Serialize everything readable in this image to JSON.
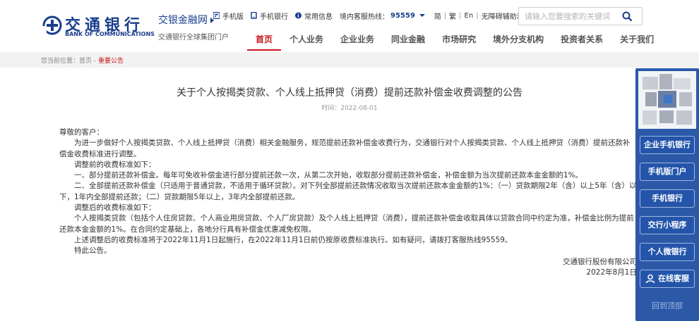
{
  "header": {
    "logo_cn": "交通银行",
    "logo_en": "BANK OF COMMUNICATIONS",
    "brand_title": "交银金融网",
    "brand_sub": "交通银行全球集团门户",
    "links": {
      "mobile_version": "手机版",
      "mobile_bank": "手机银行",
      "common_info": "常用信息",
      "hotline_label": "境内客服热线：",
      "hotline_number": "95559"
    },
    "langs": [
      "简",
      "繁",
      "En",
      "无障碍辅助浏览"
    ],
    "search_placeholder": "请输入您要搜索的关键词"
  },
  "nav": [
    "首页",
    "个人业务",
    "企业业务",
    "同业金融",
    "市场研究",
    "境外分支机构",
    "投资者关系",
    "关于我们"
  ],
  "breadcrumb": {
    "prefix": "您当前位置：首页 - ",
    "current": "重要公告"
  },
  "article": {
    "title": "关于个人按揭类贷款、个人线上抵押贷（消费）提前还款补偿金收费调整的公告",
    "time": "时间：2022-08-01",
    "greeting": "尊敬的客户：",
    "p1": "为进一步做好个人按揭类贷款、个人线上抵押贷（消费）相关金融服务，规范提前还款补偿金收费行为，交通银行对个人按揭类贷款、个人线上抵押贷（消费）提前还款补偿金收费标准进行调整。",
    "p2": "调整前的收费标准如下：",
    "p3": "一、部分提前还款补偿金。每年可免收补偿金进行部分提前还款一次，从第二次开始，收取部分提前还款补偿金，补偿金额为当次提前还款本金金额的1%。",
    "p4": "二、全部提前还款补偿金（只适用于普通贷款，不适用于循环贷款）。对下列全部提前还款情况收取当次提前还款本金金额的1%：（一）贷款期限2年（含）以上5年（含）以下，1年内全部提前还款；（二）贷款期限5年以上，3年内全部提前还款。",
    "p5": "调整后的收费标准如下：",
    "p6": "个人按揭类贷款（包括个人住房贷款、个人商业用房贷款、个人厂房贷款）及个人线上抵押贷（消费），提前还款补偿金收取具体以贷款合同中约定为准，补偿金比例为提前还款本金金额的1%。在合同约定基础上，各地分行具有补偿金优惠减免权限。",
    "p7": "上述调整后的收费标准将于2022年11月1日起施行，在2022年11月1日前仍按原收费标准执行。如有疑问，请拨打客服热线95559。",
    "p8": "特此公告。",
    "sign_org": "交通银行股份有限公司",
    "sign_date": "2022年8月1日"
  },
  "float": {
    "buttons": [
      "企业手机银行",
      "手机版门户",
      "手机银行",
      "交行小程序",
      "个人微银行"
    ],
    "online_service": "在线客服",
    "back_top": "回到顶部"
  },
  "colors": {
    "brand_blue": "#1a3e8c",
    "accent_red": "#c8161d",
    "float_blue": "#2b59a8"
  }
}
